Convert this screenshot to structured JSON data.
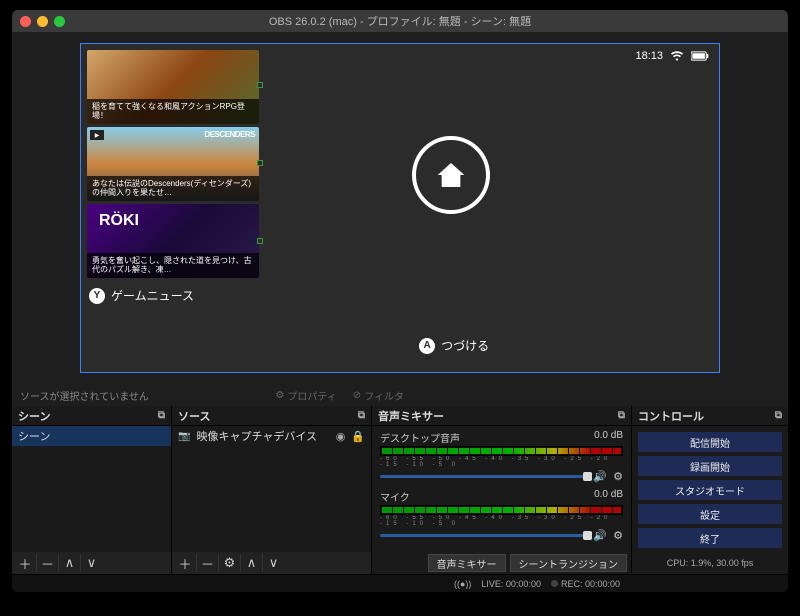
{
  "window": {
    "title": "OBS 26.0.2 (mac) - プロファイル: 無題 - シーン: 無題"
  },
  "preview": {
    "clock": "18:13",
    "news": [
      {
        "caption": "稲を育てて強くなる和風アクションRPG登場！"
      },
      {
        "caption": "あなたは伝説のDescenders(ディセンダーズ)の仲間入りを果たせ…",
        "logo": "DESCENDERS"
      },
      {
        "caption": "勇気を奮い起こし、隠された道を見つけ、古代のパズル解き、凍…",
        "logo": "RÖKI"
      }
    ],
    "news_button": "Y",
    "news_label": "ゲームニュース",
    "continue_button": "A",
    "continue_label": "つづける"
  },
  "inforow": {
    "no_selection": "ソースが選択されていません",
    "properties": "プロパティ",
    "filters": "フィルタ"
  },
  "panels": {
    "scenes": {
      "title": "シーン",
      "items": [
        "シーン"
      ]
    },
    "sources": {
      "title": "ソース",
      "items": [
        {
          "icon": "camera",
          "label": "映像キャプチャデバイス"
        }
      ]
    },
    "mixer": {
      "title": "音声ミキサー",
      "channels": [
        {
          "name": "デスクトップ音声",
          "db": "0.0 dB"
        },
        {
          "name": "マイク",
          "db": "0.0 dB"
        }
      ]
    },
    "controls": {
      "title": "コントロール",
      "buttons": [
        "配信開始",
        "録画開始",
        "スタジオモード",
        "設定",
        "終了"
      ]
    }
  },
  "dock": {
    "mixer": "音声ミキサー",
    "transition": "シーントランジション"
  },
  "statusbar": {
    "live": "LIVE: 00:00:00",
    "rec": "REC: 00:00:00",
    "cpu": "CPU: 1.9%, 30.00 fps"
  }
}
